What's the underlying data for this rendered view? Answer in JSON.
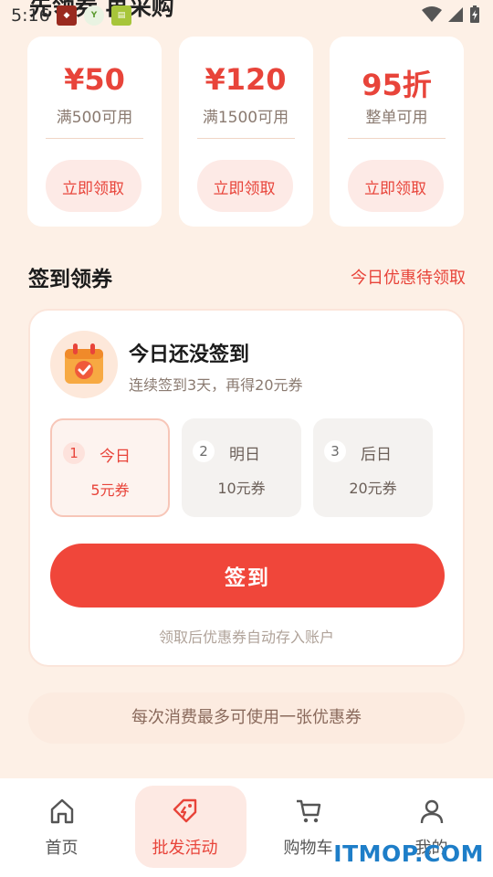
{
  "status": {
    "time": "5:16",
    "apps": [
      "app-icon-1",
      "app-icon-2",
      "app-icon-3"
    ]
  },
  "page": {
    "heading": "先领券  再采购"
  },
  "coupons": [
    {
      "value": "¥50",
      "condition": "满500可用",
      "claim": "立即领取"
    },
    {
      "value": "¥120",
      "condition": "满1500可用",
      "claim": "立即领取"
    },
    {
      "value": "95折",
      "condition": "整单可用",
      "claim": "立即领取"
    }
  ],
  "signin_section": {
    "title": "签到领券",
    "link": "今日优惠待领取",
    "card_title": "今日还没签到",
    "card_subtitle": "连续签到3天，再得20元券",
    "days": [
      {
        "num": "1",
        "label": "今日",
        "reward": "5元券",
        "active": true
      },
      {
        "num": "2",
        "label": "明日",
        "reward": "10元券",
        "active": false
      },
      {
        "num": "3",
        "label": "后日",
        "reward": "20元券",
        "active": false
      }
    ],
    "button": "签到",
    "note": "领取后优惠券自动存入账户"
  },
  "notice": "每次消费最多可使用一张优惠券",
  "nav": [
    {
      "label": "首页",
      "icon": "home-icon"
    },
    {
      "label": "批发活动",
      "icon": "tag-icon",
      "active": true
    },
    {
      "label": "购物车",
      "icon": "cart-icon"
    },
    {
      "label": "我的",
      "icon": "user-icon"
    }
  ],
  "watermark": "ITMOP.COM",
  "colors": {
    "accent": "#e8443a",
    "background": "#fdf0e6",
    "button": "#f0463a"
  }
}
